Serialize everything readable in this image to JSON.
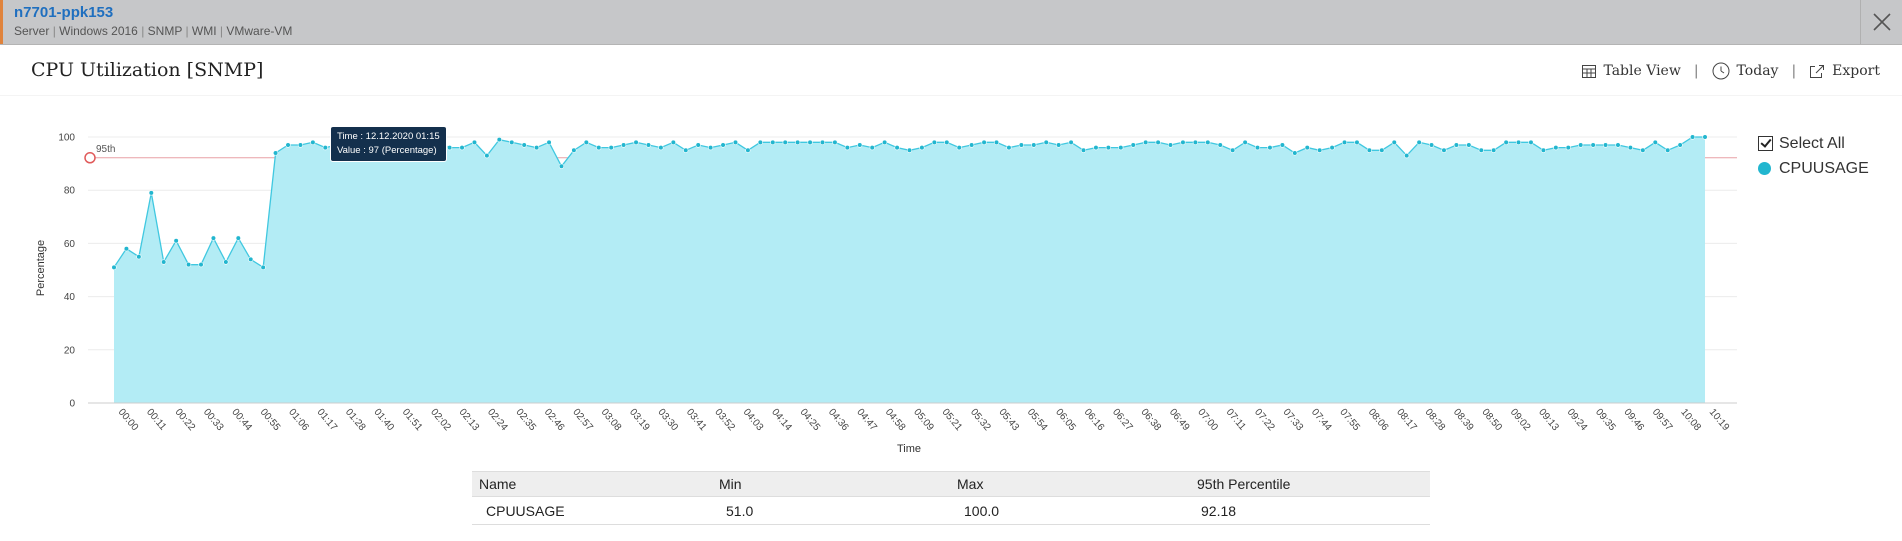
{
  "device": {
    "name": "n7701-ppk153",
    "tags": [
      "Server",
      "Windows 2016",
      "SNMP",
      "WMI",
      "VMware-VM"
    ]
  },
  "panel": {
    "title": "CPU Utilization [SNMP]"
  },
  "toolbar": {
    "table_view": "Table View",
    "period": "Today",
    "export": "Export"
  },
  "legend": {
    "select_all": "Select All",
    "series_name": "CPUUSAGE"
  },
  "colors": {
    "series_fill": "#b3ecf5",
    "series_line": "#40c8e0",
    "marker": "#22b6cf",
    "threshold": "#e8a0a5",
    "link": "#1f6fbf"
  },
  "chart_data": {
    "type": "area",
    "title": "CPU Utilization [SNMP]",
    "xlabel": "Time",
    "ylabel": "Percentage",
    "ylim": [
      0,
      100
    ],
    "yticks": [
      0,
      20,
      40,
      60,
      80,
      100
    ],
    "grid": true,
    "legend_position": "right",
    "threshold": {
      "label": "95th",
      "value": 92.18
    },
    "xtick_labels": [
      "00:00",
      "00:11",
      "00:22",
      "00:33",
      "00:44",
      "00:55",
      "01:06",
      "01:17",
      "01:28",
      "01:40",
      "01:51",
      "02:02",
      "02:13",
      "02:24",
      "02:35",
      "02:46",
      "02:57",
      "03:08",
      "03:19",
      "03:30",
      "03:41",
      "03:52",
      "04:03",
      "04:14",
      "04:25",
      "04:36",
      "04:47",
      "04:58",
      "05:09",
      "05:21",
      "05:32",
      "05:43",
      "05:54",
      "06:05",
      "06:16",
      "06:27",
      "06:38",
      "06:49",
      "07:00",
      "07:11",
      "07:22",
      "07:33",
      "07:44",
      "07:55",
      "08:06",
      "08:17",
      "08:28",
      "08:39",
      "08:50",
      "09:02",
      "09:13",
      "09:24",
      "09:35",
      "09:46",
      "09:57",
      "10:08",
      "10:19"
    ],
    "series": [
      {
        "name": "CPUUSAGE",
        "values": [
          51,
          58,
          55,
          79,
          53,
          61,
          52,
          52,
          62,
          53,
          62,
          54,
          51,
          94,
          97,
          97,
          98,
          96,
          97,
          97,
          98,
          96,
          97,
          97,
          98,
          92,
          98,
          96,
          96,
          98,
          93,
          99,
          98,
          97,
          96,
          98,
          89,
          95,
          98,
          96,
          96,
          97,
          98,
          97,
          96,
          98,
          95,
          97,
          96,
          97,
          98,
          95,
          98,
          98,
          98,
          98,
          98,
          98,
          98,
          96,
          97,
          96,
          98,
          96,
          95,
          96,
          98,
          98,
          96,
          97,
          98,
          98,
          96,
          97,
          97,
          98,
          97,
          98,
          95,
          96,
          96,
          96,
          97,
          98,
          98,
          97,
          98,
          98,
          98,
          97,
          95,
          98,
          96,
          96,
          97,
          94,
          96,
          95,
          96,
          98,
          98,
          95,
          95,
          98,
          93,
          98,
          97,
          95,
          97,
          97,
          95,
          95,
          98,
          98,
          98,
          95,
          96,
          96,
          97,
          97,
          97,
          97,
          96,
          95,
          98,
          95,
          97,
          100,
          100
        ]
      }
    ],
    "tooltip": {
      "time_label": "Time : 12.12.2020 01:15",
      "value_label": "Value : 97 (Percentage)"
    }
  },
  "summary_table": {
    "headers": [
      "Name",
      "Min",
      "Max",
      "95th Percentile"
    ],
    "rows": [
      [
        "CPUUSAGE",
        "51.0",
        "100.0",
        "92.18"
      ]
    ]
  }
}
